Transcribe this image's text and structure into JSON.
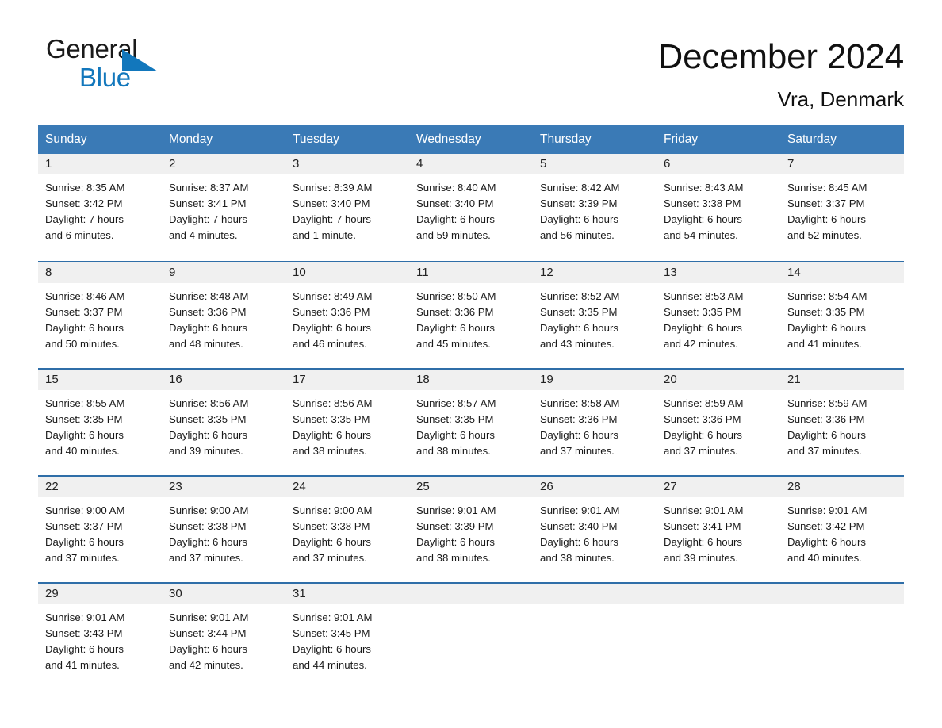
{
  "brand": {
    "name_part1": "General",
    "name_part2": "Blue",
    "accent_color": "#1277bc"
  },
  "header": {
    "title": "December 2024",
    "subtitle": "Vra, Denmark",
    "header_bg": "#3a7ab6",
    "row_border": "#2f6ea8",
    "daynum_bg": "#f0f0f0"
  },
  "weekdays": [
    "Sunday",
    "Monday",
    "Tuesday",
    "Wednesday",
    "Thursday",
    "Friday",
    "Saturday"
  ],
  "weeks": [
    [
      {
        "day": "1",
        "sunrise": "Sunrise: 8:35 AM",
        "sunset": "Sunset: 3:42 PM",
        "daylight1": "Daylight: 7 hours",
        "daylight2": "and 6 minutes."
      },
      {
        "day": "2",
        "sunrise": "Sunrise: 8:37 AM",
        "sunset": "Sunset: 3:41 PM",
        "daylight1": "Daylight: 7 hours",
        "daylight2": "and 4 minutes."
      },
      {
        "day": "3",
        "sunrise": "Sunrise: 8:39 AM",
        "sunset": "Sunset: 3:40 PM",
        "daylight1": "Daylight: 7 hours",
        "daylight2": "and 1 minute."
      },
      {
        "day": "4",
        "sunrise": "Sunrise: 8:40 AM",
        "sunset": "Sunset: 3:40 PM",
        "daylight1": "Daylight: 6 hours",
        "daylight2": "and 59 minutes."
      },
      {
        "day": "5",
        "sunrise": "Sunrise: 8:42 AM",
        "sunset": "Sunset: 3:39 PM",
        "daylight1": "Daylight: 6 hours",
        "daylight2": "and 56 minutes."
      },
      {
        "day": "6",
        "sunrise": "Sunrise: 8:43 AM",
        "sunset": "Sunset: 3:38 PM",
        "daylight1": "Daylight: 6 hours",
        "daylight2": "and 54 minutes."
      },
      {
        "day": "7",
        "sunrise": "Sunrise: 8:45 AM",
        "sunset": "Sunset: 3:37 PM",
        "daylight1": "Daylight: 6 hours",
        "daylight2": "and 52 minutes."
      }
    ],
    [
      {
        "day": "8",
        "sunrise": "Sunrise: 8:46 AM",
        "sunset": "Sunset: 3:37 PM",
        "daylight1": "Daylight: 6 hours",
        "daylight2": "and 50 minutes."
      },
      {
        "day": "9",
        "sunrise": "Sunrise: 8:48 AM",
        "sunset": "Sunset: 3:36 PM",
        "daylight1": "Daylight: 6 hours",
        "daylight2": "and 48 minutes."
      },
      {
        "day": "10",
        "sunrise": "Sunrise: 8:49 AM",
        "sunset": "Sunset: 3:36 PM",
        "daylight1": "Daylight: 6 hours",
        "daylight2": "and 46 minutes."
      },
      {
        "day": "11",
        "sunrise": "Sunrise: 8:50 AM",
        "sunset": "Sunset: 3:36 PM",
        "daylight1": "Daylight: 6 hours",
        "daylight2": "and 45 minutes."
      },
      {
        "day": "12",
        "sunrise": "Sunrise: 8:52 AM",
        "sunset": "Sunset: 3:35 PM",
        "daylight1": "Daylight: 6 hours",
        "daylight2": "and 43 minutes."
      },
      {
        "day": "13",
        "sunrise": "Sunrise: 8:53 AM",
        "sunset": "Sunset: 3:35 PM",
        "daylight1": "Daylight: 6 hours",
        "daylight2": "and 42 minutes."
      },
      {
        "day": "14",
        "sunrise": "Sunrise: 8:54 AM",
        "sunset": "Sunset: 3:35 PM",
        "daylight1": "Daylight: 6 hours",
        "daylight2": "and 41 minutes."
      }
    ],
    [
      {
        "day": "15",
        "sunrise": "Sunrise: 8:55 AM",
        "sunset": "Sunset: 3:35 PM",
        "daylight1": "Daylight: 6 hours",
        "daylight2": "and 40 minutes."
      },
      {
        "day": "16",
        "sunrise": "Sunrise: 8:56 AM",
        "sunset": "Sunset: 3:35 PM",
        "daylight1": "Daylight: 6 hours",
        "daylight2": "and 39 minutes."
      },
      {
        "day": "17",
        "sunrise": "Sunrise: 8:56 AM",
        "sunset": "Sunset: 3:35 PM",
        "daylight1": "Daylight: 6 hours",
        "daylight2": "and 38 minutes."
      },
      {
        "day": "18",
        "sunrise": "Sunrise: 8:57 AM",
        "sunset": "Sunset: 3:35 PM",
        "daylight1": "Daylight: 6 hours",
        "daylight2": "and 38 minutes."
      },
      {
        "day": "19",
        "sunrise": "Sunrise: 8:58 AM",
        "sunset": "Sunset: 3:36 PM",
        "daylight1": "Daylight: 6 hours",
        "daylight2": "and 37 minutes."
      },
      {
        "day": "20",
        "sunrise": "Sunrise: 8:59 AM",
        "sunset": "Sunset: 3:36 PM",
        "daylight1": "Daylight: 6 hours",
        "daylight2": "and 37 minutes."
      },
      {
        "day": "21",
        "sunrise": "Sunrise: 8:59 AM",
        "sunset": "Sunset: 3:36 PM",
        "daylight1": "Daylight: 6 hours",
        "daylight2": "and 37 minutes."
      }
    ],
    [
      {
        "day": "22",
        "sunrise": "Sunrise: 9:00 AM",
        "sunset": "Sunset: 3:37 PM",
        "daylight1": "Daylight: 6 hours",
        "daylight2": "and 37 minutes."
      },
      {
        "day": "23",
        "sunrise": "Sunrise: 9:00 AM",
        "sunset": "Sunset: 3:38 PM",
        "daylight1": "Daylight: 6 hours",
        "daylight2": "and 37 minutes."
      },
      {
        "day": "24",
        "sunrise": "Sunrise: 9:00 AM",
        "sunset": "Sunset: 3:38 PM",
        "daylight1": "Daylight: 6 hours",
        "daylight2": "and 37 minutes."
      },
      {
        "day": "25",
        "sunrise": "Sunrise: 9:01 AM",
        "sunset": "Sunset: 3:39 PM",
        "daylight1": "Daylight: 6 hours",
        "daylight2": "and 38 minutes."
      },
      {
        "day": "26",
        "sunrise": "Sunrise: 9:01 AM",
        "sunset": "Sunset: 3:40 PM",
        "daylight1": "Daylight: 6 hours",
        "daylight2": "and 38 minutes."
      },
      {
        "day": "27",
        "sunrise": "Sunrise: 9:01 AM",
        "sunset": "Sunset: 3:41 PM",
        "daylight1": "Daylight: 6 hours",
        "daylight2": "and 39 minutes."
      },
      {
        "day": "28",
        "sunrise": "Sunrise: 9:01 AM",
        "sunset": "Sunset: 3:42 PM",
        "daylight1": "Daylight: 6 hours",
        "daylight2": "and 40 minutes."
      }
    ],
    [
      {
        "day": "29",
        "sunrise": "Sunrise: 9:01 AM",
        "sunset": "Sunset: 3:43 PM",
        "daylight1": "Daylight: 6 hours",
        "daylight2": "and 41 minutes."
      },
      {
        "day": "30",
        "sunrise": "Sunrise: 9:01 AM",
        "sunset": "Sunset: 3:44 PM",
        "daylight1": "Daylight: 6 hours",
        "daylight2": "and 42 minutes."
      },
      {
        "day": "31",
        "sunrise": "Sunrise: 9:01 AM",
        "sunset": "Sunset: 3:45 PM",
        "daylight1": "Daylight: 6 hours",
        "daylight2": "and 44 minutes."
      },
      {
        "day": "",
        "sunrise": "",
        "sunset": "",
        "daylight1": "",
        "daylight2": ""
      },
      {
        "day": "",
        "sunrise": "",
        "sunset": "",
        "daylight1": "",
        "daylight2": ""
      },
      {
        "day": "",
        "sunrise": "",
        "sunset": "",
        "daylight1": "",
        "daylight2": ""
      },
      {
        "day": "",
        "sunrise": "",
        "sunset": "",
        "daylight1": "",
        "daylight2": ""
      }
    ]
  ]
}
